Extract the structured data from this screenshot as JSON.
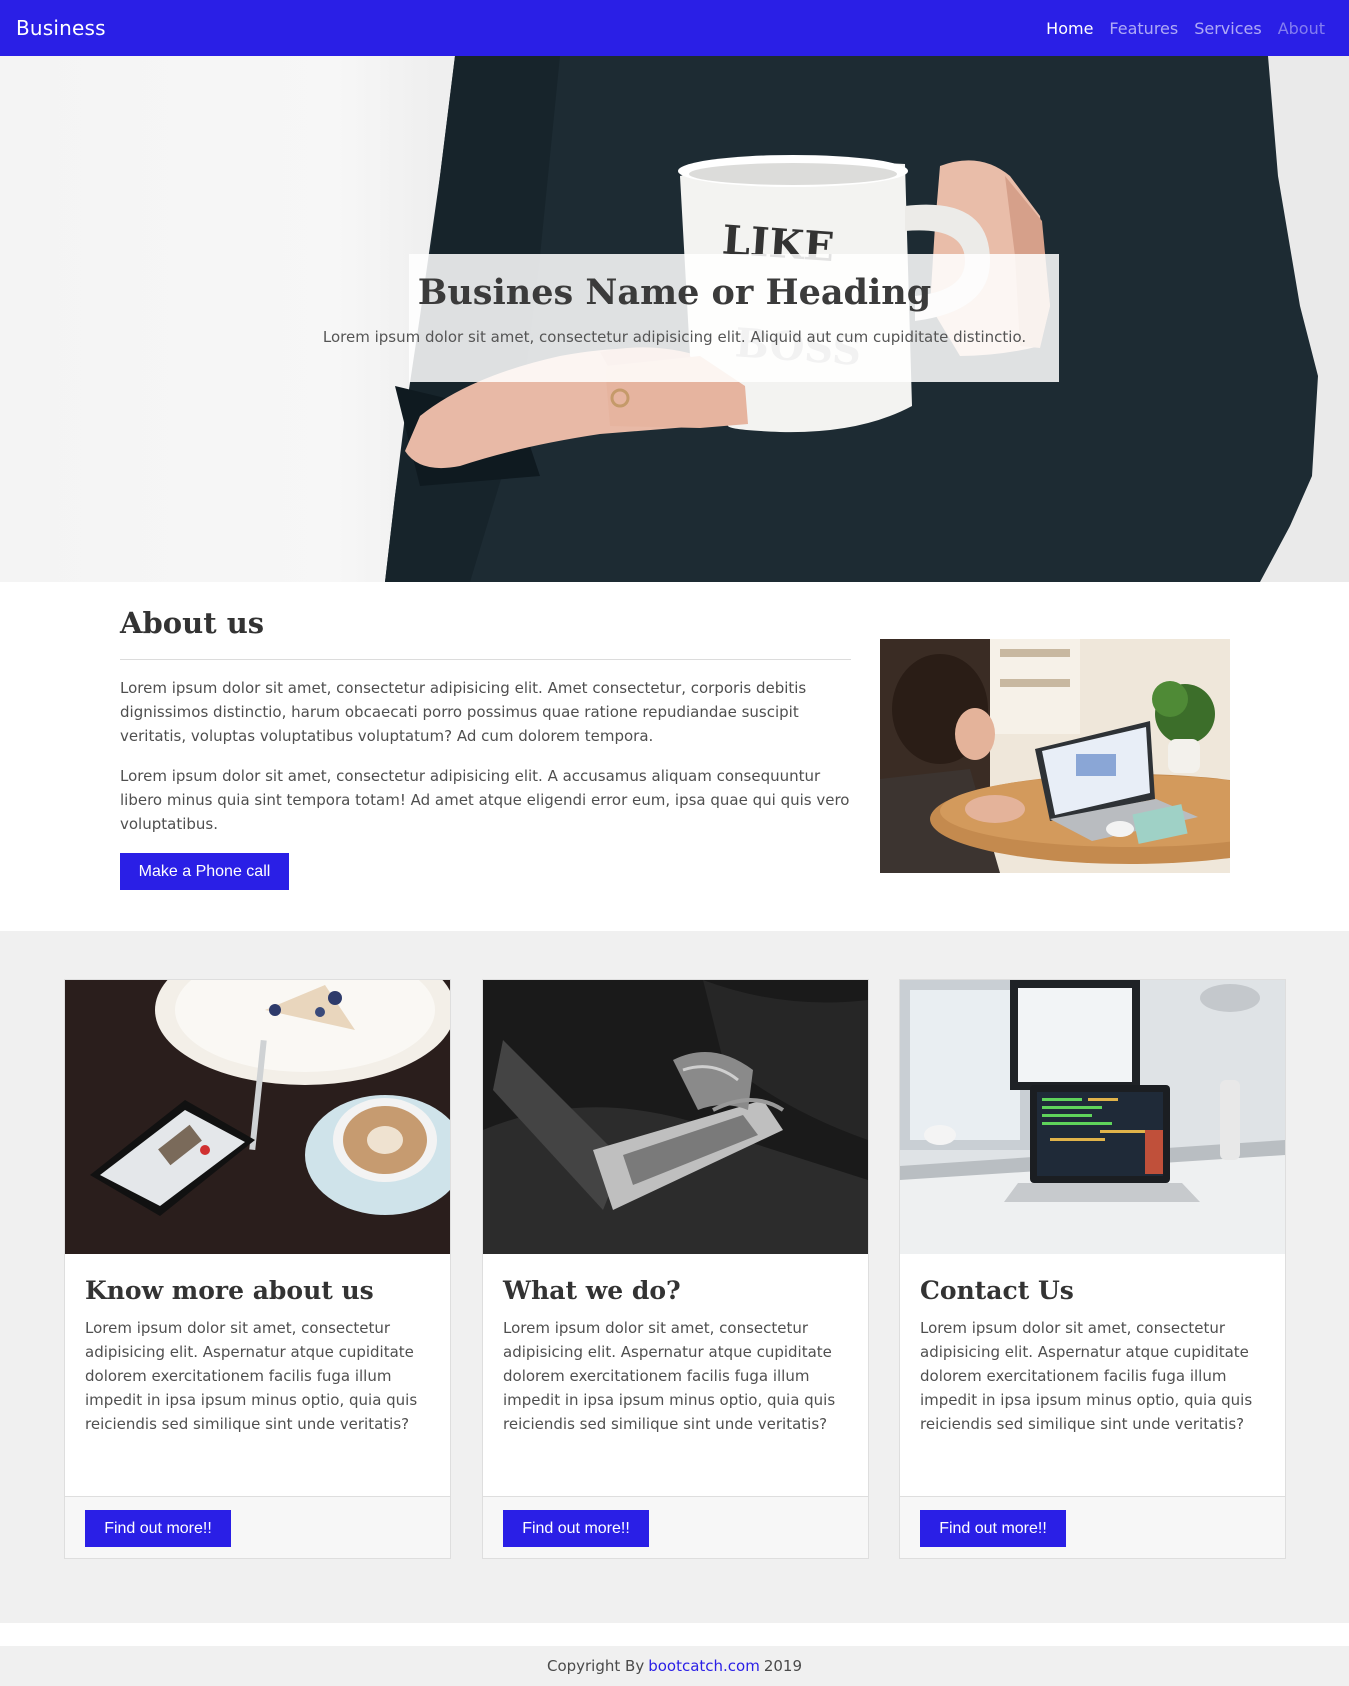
{
  "navbar": {
    "brand": "Business",
    "links": [
      {
        "label": "Home"
      },
      {
        "label": "Features"
      },
      {
        "label": "Services"
      },
      {
        "label": "About"
      }
    ]
  },
  "hero": {
    "title": "Busines Name or Heading",
    "subtitle": "Lorem ipsum dolor sit amet, consectetur adipisicing elit. Aliquid aut cum cupiditate distinctio."
  },
  "about": {
    "title": "About us",
    "paragraphs": [
      "Lorem ipsum dolor sit amet, consectetur adipisicing elit. Amet consectetur, corporis debitis dignissimos distinctio, harum obcaecati porro possimus quae ratione repudiandae suscipit veritatis, voluptas voluptatibus voluptatum? Ad cum dolorem tempora.",
      "Lorem ipsum dolor sit amet, consectetur adipisicing elit. A accusamus aliquam consequuntur libero minus quia sint tempora totam! Ad amet atque eligendi error eum, ipsa quae qui quis vero voluptatibus."
    ],
    "button_label": "Make a Phone call"
  },
  "cards": [
    {
      "title": "Know more about us",
      "text": "Lorem ipsum dolor sit amet, consectetur adipisicing elit. Aspernatur atque cupiditate dolorem exercitationem facilis fuga illum impedit in ipsa ipsum minus optio, quia quis reiciendis sed similique sint unde veritatis?",
      "button_label": "Find out more!!"
    },
    {
      "title": "What we do?",
      "text": "Lorem ipsum dolor sit amet, consectetur adipisicing elit. Aspernatur atque cupiditate dolorem exercitationem facilis fuga illum impedit in ipsa ipsum minus optio, quia quis reiciendis sed similique sint unde veritatis?",
      "button_label": "Find out more!!"
    },
    {
      "title": "Contact Us",
      "text": "Lorem ipsum dolor sit amet, consectetur adipisicing elit. Aspernatur atque cupiditate dolorem exercitationem facilis fuga illum impedit in ipsa ipsum minus optio, quia quis reiciendis sed similique sint unde veritatis?",
      "button_label": "Find out more!!"
    }
  ],
  "footer": {
    "prefix": "Copyright By",
    "link": "bootcatch.com",
    "year": "2019"
  },
  "colors": {
    "primary": "#2a1fe6",
    "section_bg": "#f0f0f0"
  }
}
